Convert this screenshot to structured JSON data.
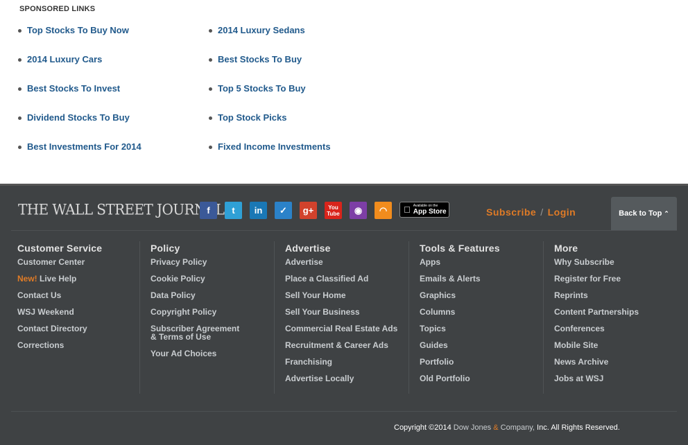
{
  "sponsored": {
    "title": "SPONSORED LINKS",
    "col1": [
      "Top Stocks To Buy Now",
      "2014 Luxury Cars",
      "Best Stocks To Invest",
      "Dividend Stocks To Buy",
      "Best Investments For 2014"
    ],
    "col2": [
      "2014 Luxury Sedans",
      "Best Stocks To Buy",
      "Top 5 Stocks To Buy",
      "Top Stock Picks",
      "Fixed Income Investments"
    ]
  },
  "footer": {
    "logo": "THE WALL STREET JOURNAL.",
    "social": {
      "facebook": "f",
      "twitter": "t",
      "linkedin": "in",
      "foursquare": "✓",
      "googleplus": "g+",
      "youtube_top": "You",
      "youtube_bottom": "Tube",
      "podcast": "◉",
      "rss": "◠"
    },
    "appstore": {
      "small": "Available on the",
      "big": "App Store"
    },
    "subscribe": "Subscribe",
    "separator": "/",
    "login": "Login",
    "back_to_top": "Back to Top",
    "back_chev": "⌃",
    "columns": [
      {
        "head": "Customer Service",
        "links": [
          "Customer Center",
          "Live Help",
          "Contact Us",
          "WSJ Weekend",
          "Contact Directory",
          "Corrections"
        ],
        "new_label": "New!"
      },
      {
        "head": "Policy",
        "links": [
          "Privacy Policy",
          "Cookie Policy",
          "Data Policy",
          "Copyright Policy",
          "Subscriber Agreement & Terms of Use",
          "Your Ad Choices"
        ]
      },
      {
        "head": "Advertise",
        "links": [
          "Advertise",
          "Place a Classified Ad",
          "Sell Your Home",
          "Sell Your Business",
          "Commercial Real Estate Ads",
          "Recruitment & Career Ads",
          "Franchising",
          "Advertise Locally"
        ]
      },
      {
        "head": "Tools & Features",
        "links": [
          "Apps",
          "Emails & Alerts",
          "Graphics",
          "Columns",
          "Topics",
          "Guides",
          "Portfolio",
          "Old Portfolio"
        ]
      },
      {
        "head": "More",
        "links": [
          "Why Subscribe",
          "Register for Free",
          "Reprints",
          "Content Partnerships",
          "Conferences",
          "Mobile Site",
          "News Archive",
          "Jobs at WSJ"
        ]
      }
    ],
    "copyright": {
      "prefix": "Copyright ©2014 ",
      "dow": "Dow Jones ",
      "amp": "&",
      "company": " Company,",
      "suffix": " Inc. All Rights Reserved."
    }
  }
}
